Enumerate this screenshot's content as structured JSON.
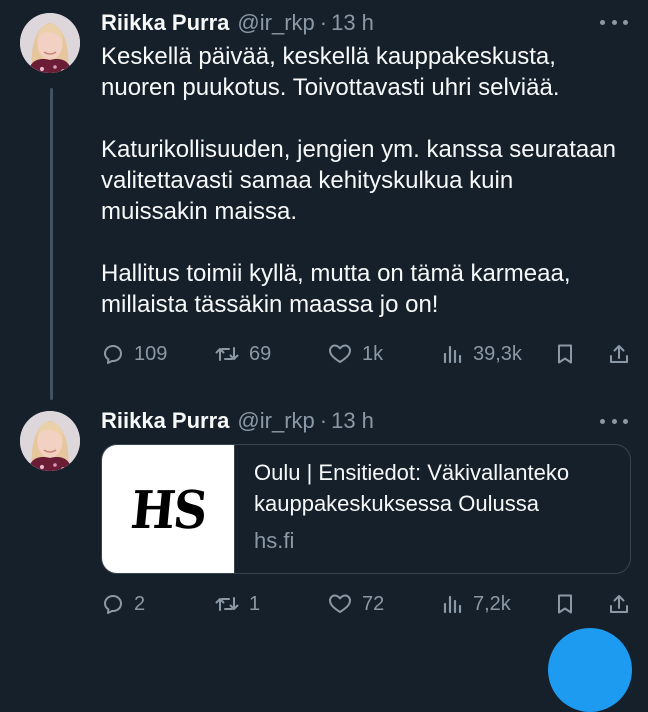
{
  "tweets": [
    {
      "author": {
        "name": "Riikka Purra",
        "handle": "@ir_rkp",
        "separator": "·",
        "time": "13 h"
      },
      "text": [
        "Keskellä päivää, keskellä kauppakeskusta, nuoren puukotus. Toivottavasti uhri selviää.",
        "Katurikollisuuden, jengien ym. kanssa seurataan valitettavasti samaa kehityskulkua kuin muissakin maissa.",
        "Hallitus toimii kyllä, mutta on tämä karmeaa, millaista tässäkin maassa jo on!"
      ],
      "stats": {
        "replies": "109",
        "reposts": "69",
        "likes": "1k",
        "views": "39,3k"
      }
    },
    {
      "author": {
        "name": "Riikka Purra",
        "handle": "@ir_rkp",
        "separator": "·",
        "time": "13 h"
      },
      "card": {
        "logo_text": "HS",
        "title": "Oulu | Ensitiedot: Väkivallanteko kauppakeskuksessa Oulussa",
        "domain": "hs.fi"
      },
      "stats": {
        "replies": "2",
        "reposts": "1",
        "likes": "72",
        "views": "7,2k"
      }
    }
  ],
  "icons": {
    "more": "more-icon",
    "reply": "reply-icon",
    "repost": "repost-icon",
    "like": "like-icon",
    "views": "views-icon",
    "bookmark": "bookmark-icon",
    "share": "share-icon",
    "compose": "compose-button"
  },
  "colors": {
    "background": "#15202b",
    "text": "#f7f9f9",
    "secondary_text": "#8b98a5",
    "border": "#38444d",
    "accent": "#1d9bf0"
  }
}
